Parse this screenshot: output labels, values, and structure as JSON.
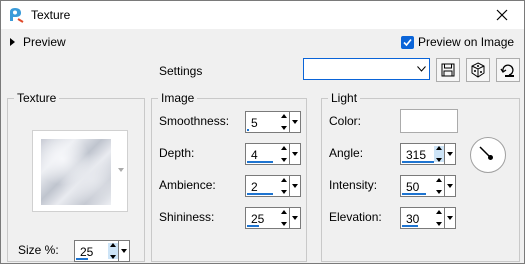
{
  "window": {
    "title": "Texture",
    "close_glyph": "✕"
  },
  "preview": {
    "label": "Preview",
    "preview_on_label": "Preview on Image",
    "preview_on_checked": true
  },
  "settings": {
    "label": "Settings",
    "preset_value": ""
  },
  "texture": {
    "group_label": "Texture",
    "size_label": "Size %:",
    "size_value": "25"
  },
  "image": {
    "group_label": "Image",
    "smoothness_label": "Smoothness:",
    "smoothness_value": "5",
    "depth_label": "Depth:",
    "depth_value": "4",
    "ambience_label": "Ambience:",
    "ambience_value": "2",
    "shininess_label": "Shininess:",
    "shininess_value": "25"
  },
  "light": {
    "group_label": "Light",
    "color_label": "Color:",
    "color_value": "#ffffff",
    "angle_label": "Angle:",
    "angle_value": "315",
    "intensity_label": "Intensity:",
    "intensity_value": "50",
    "elevation_label": "Elevation:",
    "elevation_value": "30"
  },
  "colors": {
    "accent": "#0a64d8",
    "slider": "#1e74d0",
    "background": "#f0f0f0"
  },
  "icons": {
    "app": "paint-app-icon",
    "save": "save-icon",
    "randomize": "dice-icon",
    "reset": "reset-icon",
    "dial": "angle-dial-icon"
  }
}
